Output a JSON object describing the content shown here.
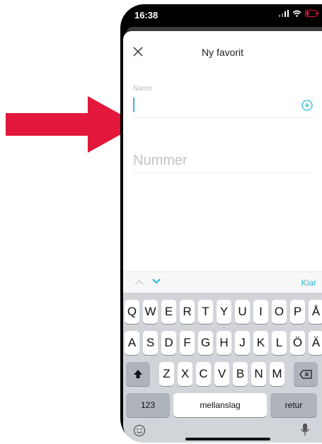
{
  "status": {
    "time": "16:38"
  },
  "nav": {
    "title": "Ny favorit",
    "close_icon": "close-icon"
  },
  "form": {
    "name_label": "Namn",
    "number_placeholder": "Nummer",
    "number_value": ""
  },
  "accessory": {
    "done": "Klar"
  },
  "keyboard": {
    "row1": [
      "Q",
      "W",
      "E",
      "R",
      "T",
      "Y",
      "U",
      "I",
      "O",
      "P",
      "Å"
    ],
    "row2": [
      "A",
      "S",
      "D",
      "F",
      "G",
      "H",
      "J",
      "K",
      "L",
      "Ö",
      "Ä"
    ],
    "row3": [
      "Z",
      "X",
      "C",
      "V",
      "B",
      "N",
      "M"
    ],
    "numbers": "123",
    "space": "mellanslag",
    "return": "retur"
  },
  "colors": {
    "accent": "#2bb8d6",
    "arrow": "#e3163c",
    "keyboard_bg": "#d1d4d9"
  }
}
